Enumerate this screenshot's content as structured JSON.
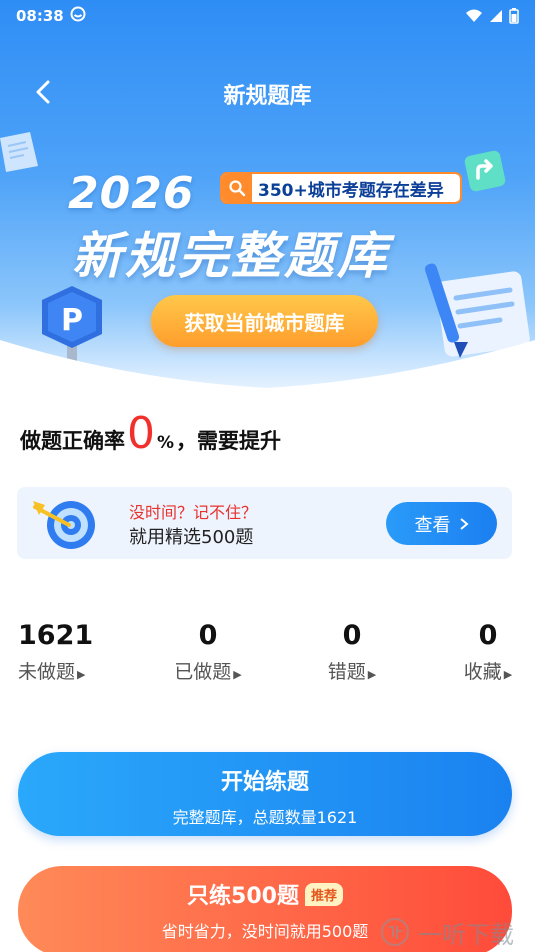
{
  "status": {
    "time": "08:38"
  },
  "nav": {
    "title": "新规题库"
  },
  "banner": {
    "year": "2026",
    "tag": "350+城市考题存在差异",
    "title": "新规完整题库",
    "city_button": "获取当前城市题库"
  },
  "accuracy": {
    "prefix": "做题正确率",
    "value": "0",
    "unit": "%",
    "suffix": "，需要提升"
  },
  "tip": {
    "line1": "没时间？记不住？",
    "line2": "就用精选500题",
    "button": "查看"
  },
  "stats": [
    {
      "value": "1621",
      "label": "未做题"
    },
    {
      "value": "0",
      "label": "已做题"
    },
    {
      "value": "0",
      "label": "错题"
    },
    {
      "value": "0",
      "label": "收藏"
    }
  ],
  "start": {
    "title": "开始练题",
    "subtitle": "完整题库，总题数量1621"
  },
  "practice": {
    "title": "只练500题",
    "badge": "推荐",
    "subtitle": "省时省力，没时间就用500题"
  },
  "watermark": {
    "text": "一听下载"
  },
  "colors": {
    "primary": "#1a82f0",
    "accent_red": "#f2302b",
    "orange": "#ff9d2c"
  }
}
